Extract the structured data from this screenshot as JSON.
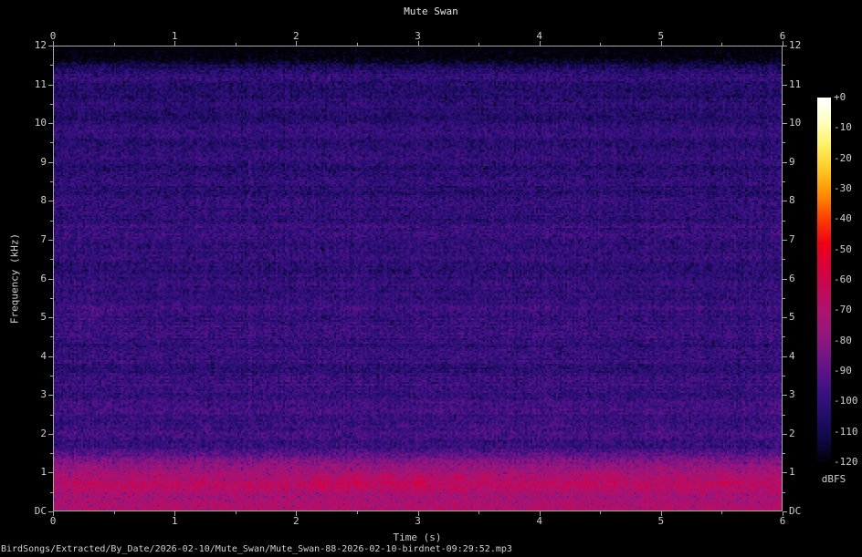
{
  "header": {
    "title": "Mute Swan"
  },
  "footer": {
    "file_path": "BirdSongs/Extracted/By_Date/2026-02-10/Mute_Swan/Mute_Swan-88-2026-02-10-birdnet-09:29:52.mp3"
  },
  "chart_data": {
    "type": "heatmap",
    "subtype": "audio-spectrogram",
    "title": "Mute Swan",
    "xlabel": "Time (s)",
    "ylabel": "Frequency (kHz)",
    "xlim_s": [
      0,
      6
    ],
    "x_tick_labels": [
      "0",
      "1",
      "2",
      "3",
      "4",
      "5",
      "6"
    ],
    "x_minor_step_s": 0.5,
    "ylim_khz": [
      0,
      12
    ],
    "y_tick_labels": [
      "12",
      "11",
      "10",
      "9",
      "8",
      "7",
      "6",
      "5",
      "4",
      "3",
      "2",
      "1",
      "DC"
    ],
    "y_minor_step_khz": 0.5,
    "grid": false,
    "axes_color": "#a8a8a8",
    "text_color": "#cfcfcf",
    "background_color": "#000000",
    "colorbar": {
      "unit": "dBFS",
      "range_db": [
        0,
        -120
      ],
      "labels": [
        "+0",
        "-10",
        "-20",
        "-30",
        "-40",
        "-50",
        "-60",
        "-70",
        "-80",
        "-90",
        "-100",
        "-110",
        "-120"
      ],
      "palette": [
        [
          0,
          "#ffffff"
        ],
        [
          -8,
          "#ffffc0"
        ],
        [
          -16,
          "#fff060"
        ],
        [
          -24,
          "#ffc820"
        ],
        [
          -32,
          "#ff8c00"
        ],
        [
          -40,
          "#ff3c00"
        ],
        [
          -48,
          "#f00014"
        ],
        [
          -56,
          "#d8003c"
        ],
        [
          -64,
          "#c00a5c"
        ],
        [
          -72,
          "#a81474"
        ],
        [
          -80,
          "#8c1680"
        ],
        [
          -88,
          "#661488"
        ],
        [
          -96,
          "#3f1184"
        ],
        [
          -104,
          "#230e6e"
        ],
        [
          -112,
          "#100848"
        ],
        [
          -120,
          "#020108"
        ]
      ]
    },
    "freq_profile_db": [
      [
        0,
        -72
      ],
      [
        0.3,
        -71
      ],
      [
        0.55,
        -69
      ],
      [
        0.9,
        -70
      ],
      [
        1.15,
        -76
      ],
      [
        1.3,
        -84
      ],
      [
        1.65,
        -96
      ],
      [
        2,
        -97.5
      ],
      [
        6,
        -99.4
      ],
      [
        11.35,
        -102
      ],
      [
        11.5,
        -108
      ],
      [
        11.62,
        -118
      ],
      [
        11.72,
        -124
      ],
      [
        12,
        -126
      ]
    ],
    "hotspots": [
      [
        2.2,
        0.75,
        5,
        0.05,
        0.1
      ],
      [
        2.45,
        0.8,
        6,
        0.08,
        0.12
      ],
      [
        2.75,
        0.85,
        7,
        0.06,
        0.1
      ],
      [
        3.0,
        0.8,
        7,
        0.07,
        0.1
      ],
      [
        3.3,
        0.85,
        6,
        0.06,
        0.1
      ],
      [
        3.55,
        0.8,
        5,
        0.06,
        0.1
      ],
      [
        4.5,
        0.85,
        4,
        0.15,
        0.12
      ],
      [
        5.6,
        0.8,
        4,
        0.1,
        0.1
      ],
      [
        2.6,
        1.9,
        3,
        0.05,
        0.1
      ],
      [
        3.5,
        2.15,
        4,
        0.06,
        0.12
      ],
      [
        3.7,
        2.3,
        3.5,
        0.05,
        0.1
      ],
      [
        3.95,
        2.2,
        3.5,
        0.06,
        0.1
      ],
      [
        4.15,
        2.3,
        3,
        0.05,
        0.1
      ],
      [
        5.0,
        2.1,
        3,
        0.08,
        0.1
      ],
      [
        3.45,
        4.95,
        3,
        0.1,
        0.15
      ],
      [
        0.3,
        5.05,
        3,
        0.15,
        0.2
      ]
    ],
    "noise": {
      "seed": 1337,
      "pixel_amp_db": 7,
      "row_amp_db": 2.2,
      "col_amp_db": 1.6,
      "dark_speckle_prob": 0.07,
      "dark_speckle_db": 9,
      "stripe_db": 1.6
    }
  }
}
